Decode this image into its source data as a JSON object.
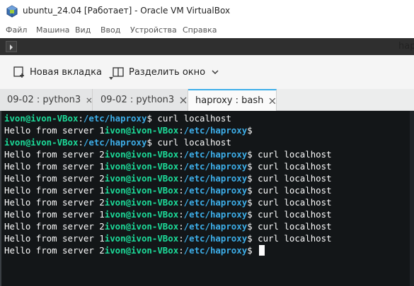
{
  "window": {
    "title": "ubuntu_24.04 [Работает] - Oracle VM VirtualBox",
    "icon": "virtualbox-icon"
  },
  "menu": {
    "items": [
      "Файл",
      "Машина",
      "Вид",
      "Ввод",
      "Устройства",
      "Справка"
    ]
  },
  "konsole": {
    "title": "hap",
    "toolbar": {
      "new_tab_label": "Новая вкладка",
      "split_label": "Разделить окно"
    },
    "tabs": [
      {
        "label": "09-02 : python3",
        "active": false
      },
      {
        "label": "09-02 : python3",
        "active": false
      },
      {
        "label": "haproxy : bash",
        "active": true
      }
    ]
  },
  "terminal": {
    "prompt_user": "ivon@ivon-VBox",
    "prompt_sep": ":",
    "prompt_path": "/etc/haproxy",
    "prompt_end": "$",
    "lines": [
      {
        "out": "",
        "cmd": " curl localhost"
      },
      {
        "out": "Hello from server 1",
        "cmd": ""
      },
      {
        "out": "",
        "cmd": " curl localhost"
      },
      {
        "out": "Hello from server 2",
        "cmd": " curl localhost"
      },
      {
        "out": "Hello from server 1",
        "cmd": " curl localhost"
      },
      {
        "out": "Hello from server 2",
        "cmd": " curl localhost"
      },
      {
        "out": "Hello from server 1",
        "cmd": " curl localhost"
      },
      {
        "out": "Hello from server 2",
        "cmd": " curl localhost"
      },
      {
        "out": "Hello from server 1",
        "cmd": " curl localhost"
      },
      {
        "out": "Hello from server 2",
        "cmd": " curl localhost"
      },
      {
        "out": "Hello from server 1",
        "cmd": " curl localhost"
      },
      {
        "out": "Hello from server 2",
        "cmd": " "
      }
    ]
  },
  "colors": {
    "terminal_bg": "#131618",
    "prompt_user": "#1cdc9a",
    "prompt_path": "#3daee9",
    "active_tab_accent": "#3daee9"
  }
}
